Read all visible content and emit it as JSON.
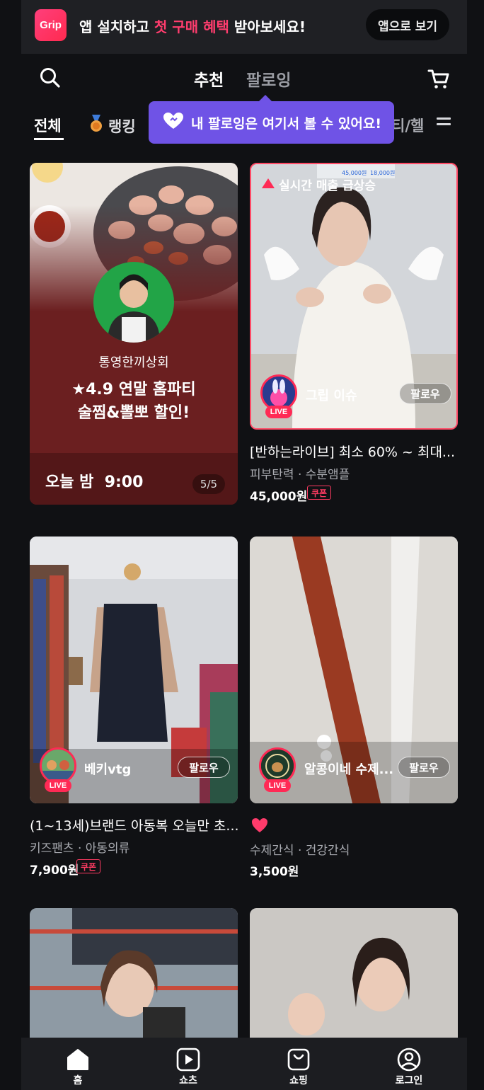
{
  "promo": {
    "logo_text": "Grip",
    "text_before": "앱 설치하고 ",
    "text_highlight": "첫 구매 혜택",
    "text_after": " 받아보세요!",
    "button_label": "앱으로 보기"
  },
  "header": {
    "tabs": [
      {
        "label": "추천",
        "active": true
      },
      {
        "label": "팔로잉",
        "active": false
      }
    ]
  },
  "categories": {
    "items": [
      {
        "label": "전체",
        "active": true
      },
      {
        "label": "랭킹",
        "icon": "medal-icon"
      },
      {
        "label": "티/헬"
      }
    ]
  },
  "tooltip": {
    "text": "내 팔로잉은 여기서 볼 수 있어요!"
  },
  "cards": [
    {
      "type": "scheduled",
      "shop_name": "통영한끼상회",
      "headline_1": "★4.9 연말 홈파티",
      "headline_2": "술찜&뽈뽀 할인!",
      "time": "오늘 밤  9:00",
      "page_indicator": "5/5"
    },
    {
      "type": "live",
      "badge": "실시간 매출 급상승",
      "streamer": "그립 이슈",
      "live_label": "LIVE",
      "follow_label": "팔로우",
      "title": "[반하는라이브] 최소 60% ~ 최대...",
      "tags": "피부탄력 · 수분앰플",
      "price": "45,000원",
      "coupon": "쿠폰",
      "thumb_price_before": "45,000원",
      "thumb_price_after": "18,000원"
    },
    {
      "type": "live",
      "streamer": "베키vtg",
      "live_label": "LIVE",
      "follow_label": "팔로우",
      "title": "(1~13세)브랜드 아동복 오늘만 초...",
      "tags": "키즈팬츠 · 아동의류",
      "price": "7,900원",
      "coupon": "쿠폰"
    },
    {
      "type": "live",
      "streamer": "알콩이네 수제...",
      "live_label": "LIVE",
      "follow_label": "팔로우",
      "tags": "수제간식 · 건강간식",
      "price": "3,500원"
    }
  ],
  "bottom_nav": [
    {
      "label": "홈",
      "icon": "home-icon"
    },
    {
      "label": "쇼츠",
      "icon": "play-icon"
    },
    {
      "label": "쇼핑",
      "icon": "shopping-bag-icon"
    },
    {
      "label": "로그인",
      "icon": "user-icon"
    }
  ],
  "colors": {
    "background": "#101114",
    "accent_pink": "#ff2a55",
    "tooltip_purple": "#6f53e6",
    "card_scheduled": "#6b1f20"
  }
}
